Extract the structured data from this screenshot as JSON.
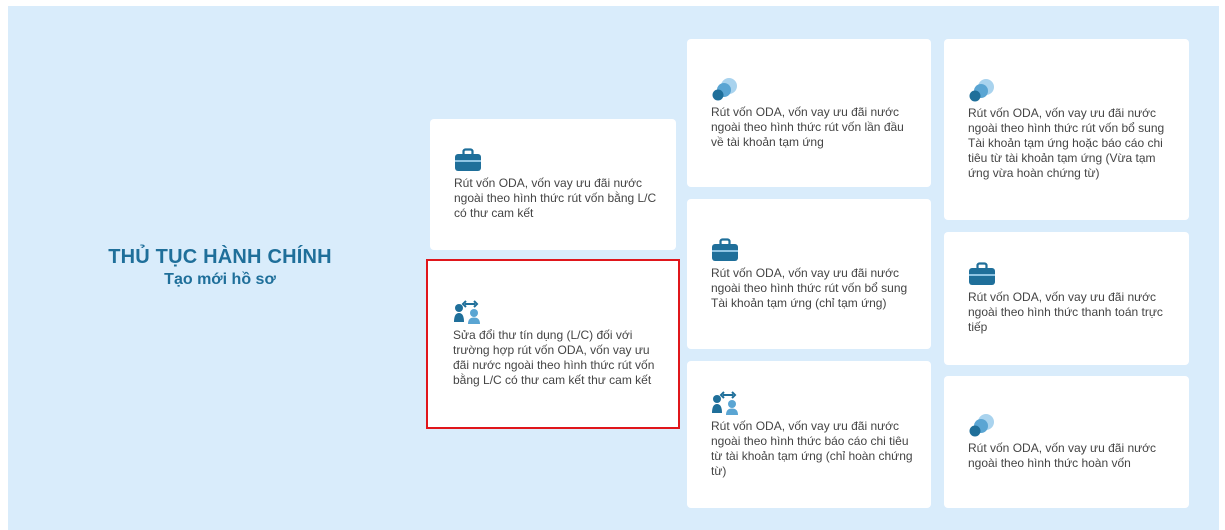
{
  "heading": {
    "title": "THỦ TỤC HÀNH CHÍNH",
    "subtitle": "Tạo mới hồ sơ"
  },
  "colors": {
    "icon": "#1f6f9a",
    "icon_light": "#8fc4e3",
    "selected_border": "#e0161b"
  },
  "cards": [
    {
      "id": "lc",
      "icon": "briefcase-icon",
      "label": "Rút vốn ODA, vốn vay ưu đãi nước ngoài theo hình thức rút vốn bằng L/C có thư cam kết"
    },
    {
      "id": "lc-amend",
      "icon": "exchange-users-icon",
      "label": "Sửa đổi thư tín dụng (L/C) đối với trường hợp rút vốn ODA, vốn vay ưu đãi nước ngoài theo hình thức rút vốn bằng L/C có thư cam kết thư cam kết"
    },
    {
      "id": "first-advance",
      "icon": "circles-icon",
      "label": "Rút vốn ODA, vốn vay ưu đãi nước ngoài theo hình thức rút vốn lần đầu về tài khoản tạm ứng"
    },
    {
      "id": "supplement-advance",
      "icon": "briefcase-icon",
      "label": "Rút vốn ODA, vốn vay ưu đãi nước ngoài theo hình thức rút vốn bổ sung Tài khoản tạm ứng (chỉ tạm ứng)"
    },
    {
      "id": "report-advance",
      "icon": "exchange-users-icon",
      "label": "Rút vốn ODA, vốn vay ưu đãi nước ngoài theo hình thức báo cáo chi tiêu từ tài khoản tạm ứng (chỉ hoàn chứng từ)"
    },
    {
      "id": "supplement-or-report",
      "icon": "circles-icon",
      "label": "Rút vốn ODA, vốn vay ưu đãi nước ngoài theo hình thức rút vốn bổ sung Tài khoản tạm ứng hoặc báo cáo chi tiêu từ tài khoản tạm ứng (Vừa tạm ứng vừa hoàn chứng từ)"
    },
    {
      "id": "direct-payment",
      "icon": "briefcase-icon",
      "label": "Rút vốn ODA, vốn vay ưu đãi nước ngoài theo hình thức thanh toán trực tiếp"
    },
    {
      "id": "reimbursement",
      "icon": "circles-icon",
      "label": "Rút vốn ODA, vốn vay ưu đãi nước ngoài theo hình thức hoàn vốn"
    }
  ]
}
